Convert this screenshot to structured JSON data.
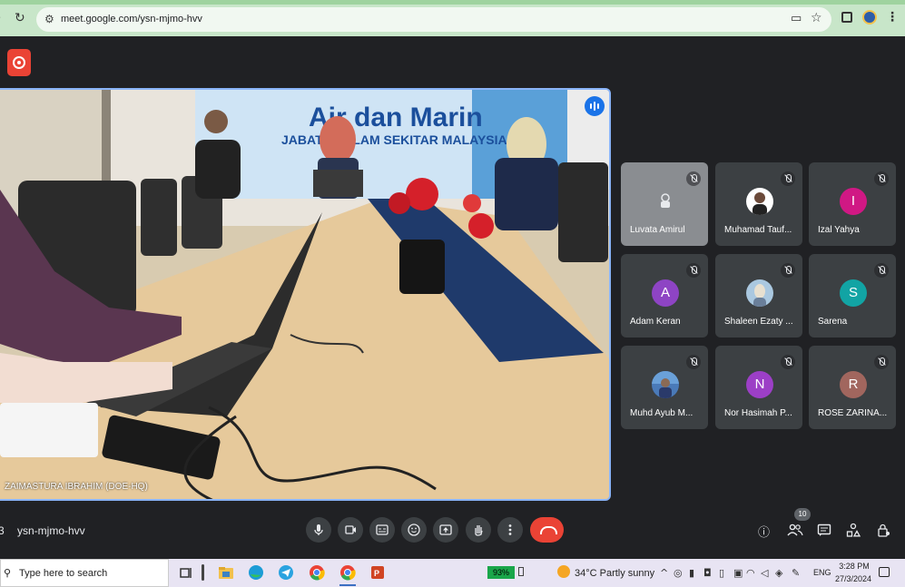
{
  "browser": {
    "url": "meet.google.com/ysn-mjmo-hvv"
  },
  "main_video": {
    "speaker_name": "ZAIMASTURA IBRAHIM (DOE-HQ)",
    "banner_text_1": "Air dan Marin",
    "banner_text_2": "JABATAN ALAM SEKITAR MALAYSIA"
  },
  "participants": [
    {
      "name": "Luvata Amirul",
      "initial": "",
      "color": "#8a8d91",
      "type": "icon"
    },
    {
      "name": "Muhamad Tauf...",
      "initial": "",
      "color": "#ffffff",
      "type": "photo"
    },
    {
      "name": "Izal Yahya",
      "initial": "I",
      "color": "#d01884",
      "type": "letter"
    },
    {
      "name": "Adam Keran",
      "initial": "A",
      "color": "#8e44c4",
      "type": "letter"
    },
    {
      "name": "Shaleen Ezaty ...",
      "initial": "",
      "color": "#aac8e0",
      "type": "photo"
    },
    {
      "name": "Sarena",
      "initial": "S",
      "color": "#12a4a4",
      "type": "letter"
    },
    {
      "name": "Muhd Ayub M...",
      "initial": "",
      "color": "#4a7ab8",
      "type": "photo"
    },
    {
      "name": "Nor Hasimah P...",
      "initial": "N",
      "color": "#9c3fc6",
      "type": "letter"
    },
    {
      "name": "ROSE ZARINA...",
      "initial": "R",
      "color": "#a1665e",
      "type": "letter"
    }
  ],
  "meeting_bar": {
    "separator": "3",
    "meeting_code": "ysn-mjmo-hvv",
    "participant_count": "10"
  },
  "taskbar": {
    "search_placeholder": "Type here to search",
    "battery": "93%",
    "weather": "34°C  Partly sunny",
    "language": "ENG",
    "time": "3:28 PM",
    "date": "27/3/2024"
  }
}
